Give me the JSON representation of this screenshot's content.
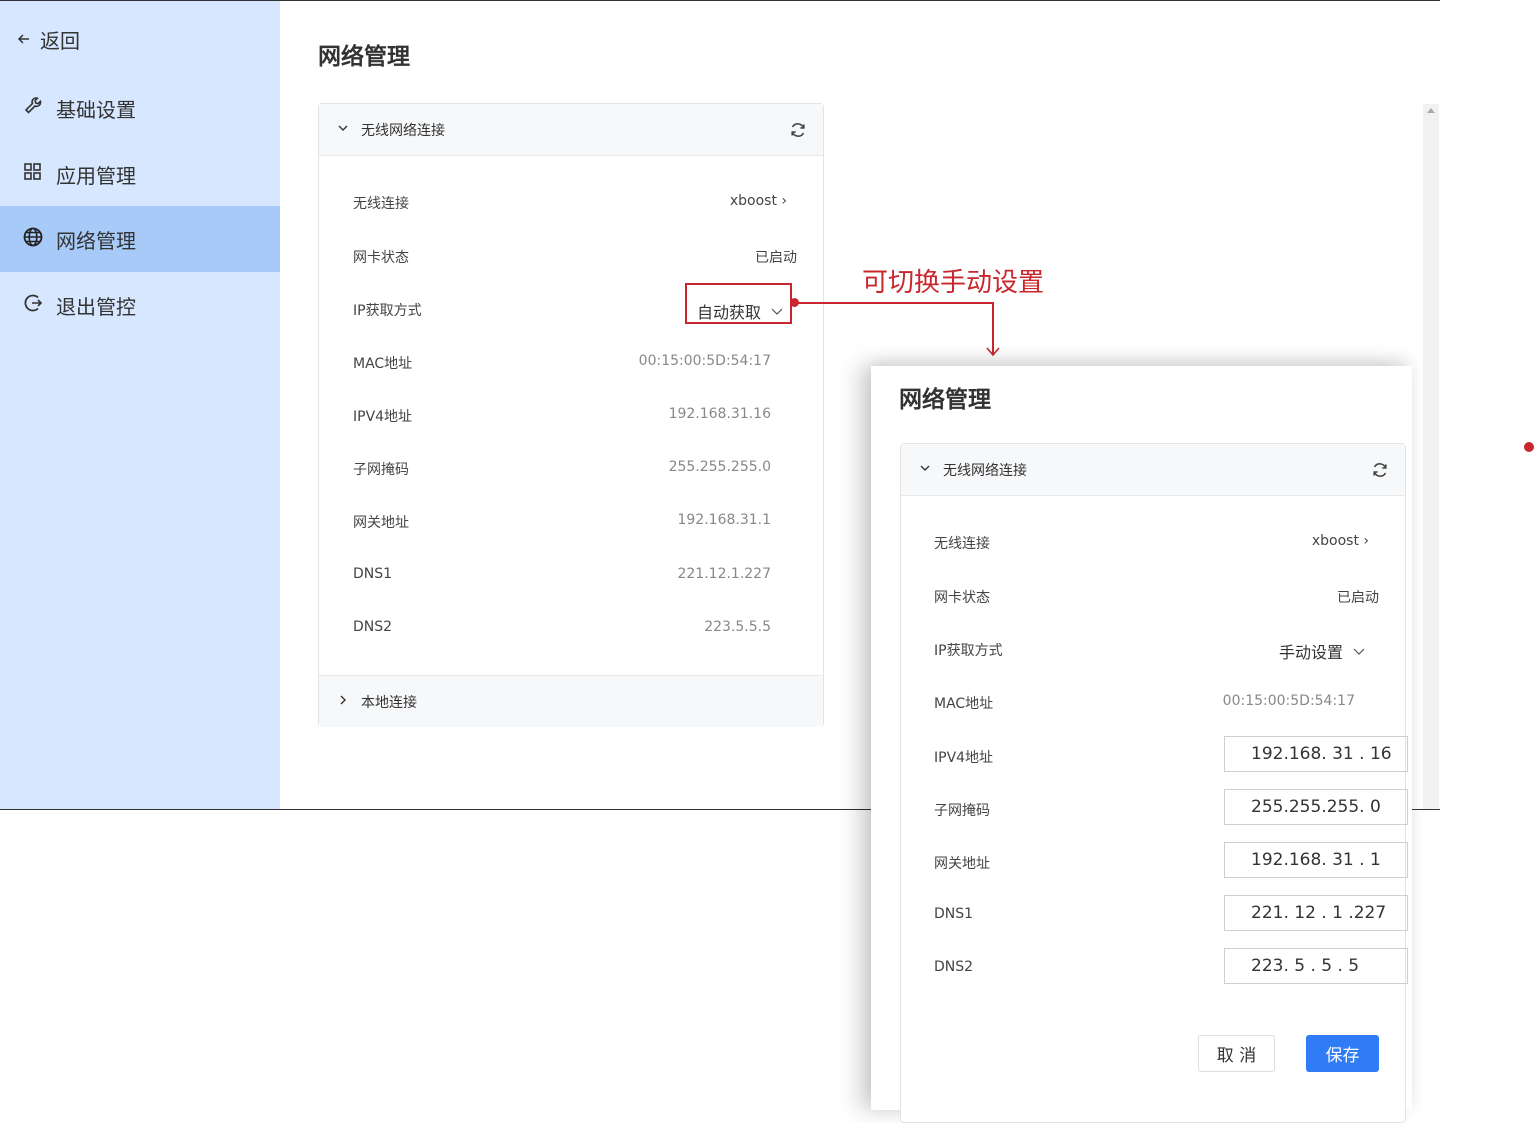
{
  "sidebar": {
    "back_label": "返回",
    "items": [
      {
        "label": "基础设置"
      },
      {
        "label": "应用管理"
      },
      {
        "label": "网络管理"
      },
      {
        "label": "退出管控"
      }
    ]
  },
  "main": {
    "title": "网络管理",
    "wireless_section": "无线网络连接",
    "rows": {
      "wireless_label": "无线连接",
      "wireless_value": "xboost",
      "nic_label": "网卡状态",
      "nic_value": "已启动",
      "ipmode_label": "IP获取方式",
      "ipmode_value": "自动获取",
      "mac_label": "MAC地址",
      "mac_value": "00:15:00:5D:54:17",
      "ipv4_label": "IPV4地址",
      "ipv4_value": "192.168.31.16",
      "mask_label": "子网掩码",
      "mask_value": "255.255.255.0",
      "gw_label": "网关地址",
      "gw_value": "192.168.31.1",
      "dns1_label": "DNS1",
      "dns1_value": "221.12.1.227",
      "dns2_label": "DNS2",
      "dns2_value": "223.5.5.5"
    },
    "local_section": "本地连接"
  },
  "annotation": {
    "text": "可切换手动设置",
    "color": "#c8282d"
  },
  "overlay": {
    "title": "网络管理",
    "wireless_section": "无线网络连接",
    "wireless_label": "无线连接",
    "wireless_value": "xboost",
    "nic_label": "网卡状态",
    "nic_value": "已启动",
    "ipmode_label": "IP获取方式",
    "ipmode_value": "手动设置",
    "mac_label": "MAC地址",
    "mac_value": "00:15:00:5D:54:17",
    "ipv4_label": "IPV4地址",
    "ipv4_value": "192.168. 31 . 16",
    "mask_label": "子网掩码",
    "mask_value": "255.255.255.  0",
    "gw_label": "网关地址",
    "gw_value": "192.168. 31 .  1",
    "dns1_label": "DNS1",
    "dns1_value": "221. 12 .  1  .227",
    "dns2_label": "DNS2",
    "dns2_value": "223.  5  .  5  .  5",
    "cancel_label": "取 消",
    "save_label": "保存",
    "save_color": "#2f7cf6"
  }
}
